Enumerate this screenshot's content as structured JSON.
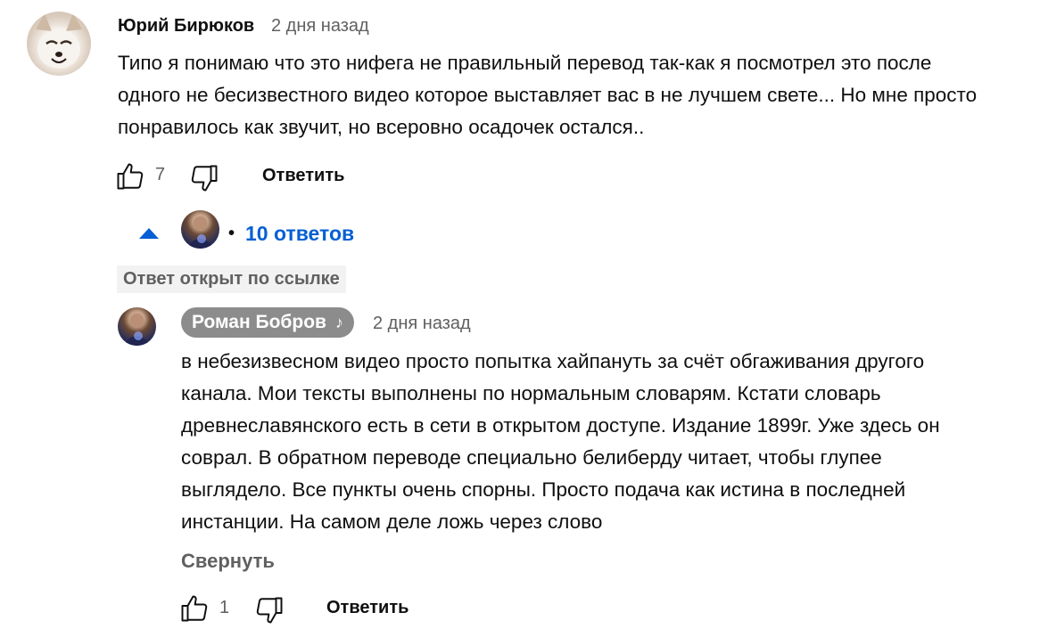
{
  "comment": {
    "author": "Юрий Бирюков",
    "time": "2 дня назад",
    "text": "Типо я понимаю что это нифега не правильный перевод так-как я посмотрел это после одного не бесизвестного видео которое выставляет вас в не лучшем свете... Но мне просто понравилось как звучит, но всеровно осадочек остался..",
    "like_count": "7",
    "reply_label": "Ответить"
  },
  "replies_toggle": {
    "label": "10 ответов",
    "separator": "•"
  },
  "linked_badge": "Ответ открыт по ссылке",
  "reply": {
    "author": "Роман Бобров",
    "author_icon": "music-note-icon",
    "time": "2 дня назад",
    "text": "в небезизвесном видео просто попытка хайпануть за счёт обгаживания другого канала. Мои тексты выполнены по нормальным словарям. Кстати словарь древнеславянского есть в сети в открытом доступе. Издание 1899г. Уже здесь он соврал. В обратном переводе специально белиберду читает, чтобы глупее выглядело. Все пункты очень спорны. Просто подача как истина в последней инстанции. На самом деле ложь через слово",
    "collapse_label": "Свернуть",
    "like_count": "1",
    "reply_label": "Ответить"
  },
  "colors": {
    "link_blue": "#065fd4",
    "secondary_text": "#606060",
    "owner_chip_bg": "#8c8c8c"
  }
}
